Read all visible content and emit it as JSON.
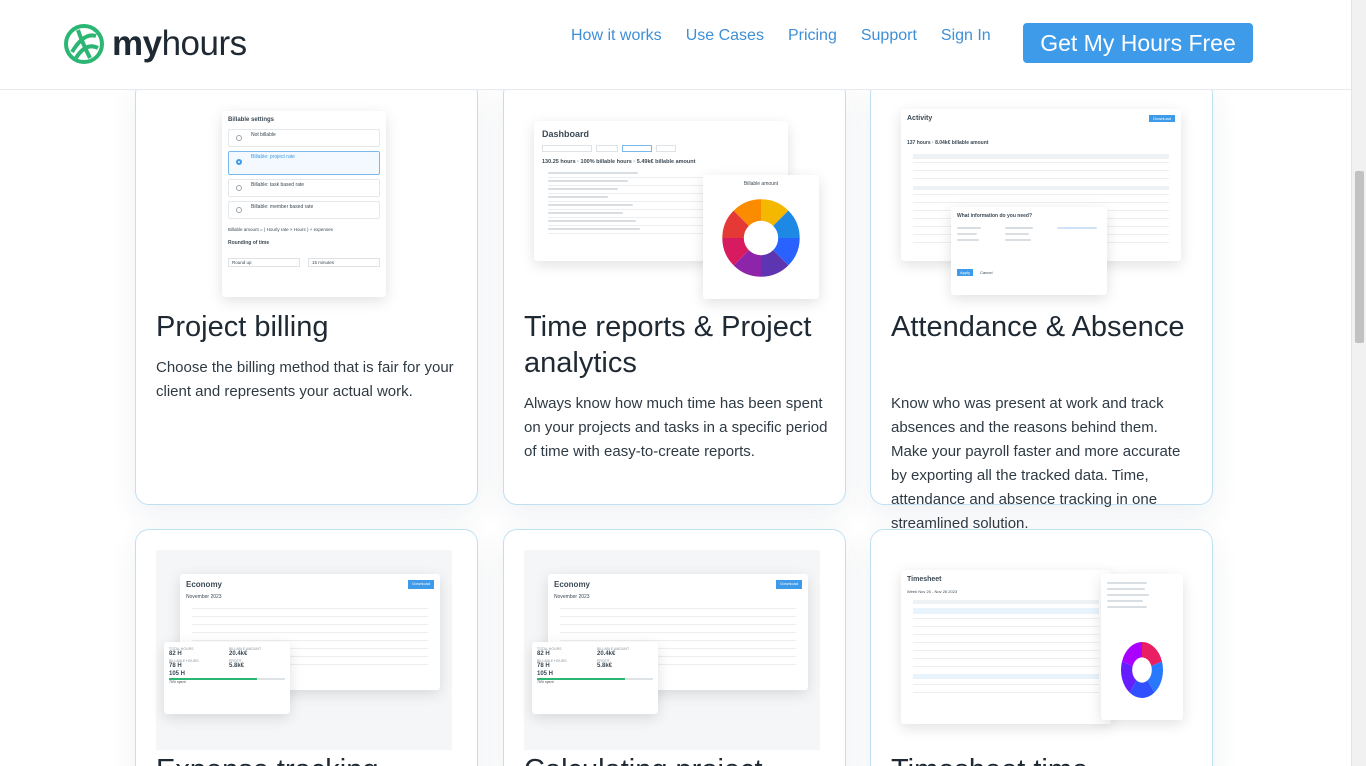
{
  "brand": {
    "name_bold": "my",
    "name_light": "hours"
  },
  "nav": {
    "items": [
      "How it works",
      "Use Cases",
      "Pricing",
      "Support",
      "Sign In"
    ],
    "cta_label": "Get My Hours Free"
  },
  "cards": [
    {
      "title": "Project billing",
      "description": "Choose the billing method that is fair for your client and represents your actual work.",
      "shot": {
        "header": "Billable settings",
        "options": [
          "Not billable",
          "Billable: project rate",
          "Billable: task based rate",
          "Billable: member based rate"
        ],
        "formula": "Billable amount = (  Hourly rate  ×  Hours  )  + expenses",
        "rounding_label": "Rounding of time",
        "round_select": "Round up",
        "minutes_select": "15 minutes"
      }
    },
    {
      "title": "Time reports & Project analytics",
      "description": "Always know how much time has been spent on your projects and tasks in a specific period of time with easy-to-create reports.",
      "shot": {
        "header": "Dashboard",
        "summary": "130.25 hours · 100% billable hours · 5.49k€ billable amount",
        "popup_label": "Billable amount",
        "donut_colors": [
          "#f5b800",
          "#1e88e5",
          "#2962ff",
          "#5e35b1",
          "#8e24aa",
          "#d81b60",
          "#e53935",
          "#fb8c00"
        ]
      }
    },
    {
      "title": "Attendance & Absence",
      "description": "Know who was present at work and track absences and the reasons behind them. Make your payroll faster and more accurate by exporting all the tracked data. Time, attendance and absence tracking in one streamlined solution.",
      "shot": {
        "header": "Activity",
        "summary": "137 hours · 8.04k€ billable amount",
        "dialog_title": "What information do you need?",
        "apply": "Apply",
        "cancel": "Cancel",
        "download": "Download"
      }
    },
    {
      "title": "Expense tracking",
      "shot": {
        "header": "Economy",
        "month": "November 2023",
        "download": "Download",
        "stats": [
          {
            "label": "TOTAL HOURS",
            "value": "82 H"
          },
          {
            "label": "BILLABLE AMOUNT",
            "value": "20.4k€"
          },
          {
            "label": "BILLABLE HOURS",
            "value": "78 H"
          },
          {
            "label": "PROFIT",
            "value": "5.8k€"
          }
        ],
        "budget": "105 H",
        "budget_note": "76% spent"
      }
    },
    {
      "title": "Calculating project",
      "shot": {
        "header": "Economy",
        "month": "November 2023",
        "download": "Download",
        "stats": [
          {
            "label": "TOTAL HOURS",
            "value": "82 H"
          },
          {
            "label": "BILLABLE AMOUNT",
            "value": "20.4k€"
          },
          {
            "label": "BILLABLE HOURS",
            "value": "78 H"
          },
          {
            "label": "PROFIT",
            "value": "5.8k€"
          }
        ],
        "budget": "105 H",
        "budget_note": "76% spent"
      }
    },
    {
      "title": "Timesheet time",
      "shot": {
        "header": "Timesheet",
        "week": "Week Nov 20 - Nov 26 2023",
        "donut_colors": [
          "#e91e63",
          "#2979ff",
          "#304ffe",
          "#651fff",
          "#aa00ff"
        ]
      }
    }
  ],
  "colors": {
    "accent": "#3d9be9",
    "link": "#3f8fd6",
    "card_border": "#bfe0f3",
    "logo": "#2bb673"
  }
}
